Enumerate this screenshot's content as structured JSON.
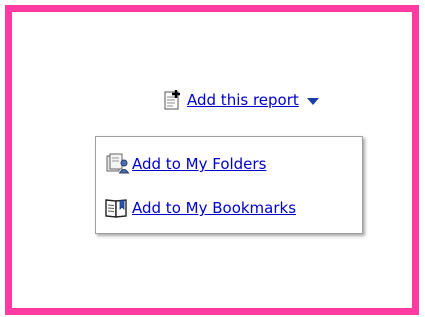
{
  "add_report": {
    "label": "Add this report",
    "icon": "add-report-icon"
  },
  "menu": {
    "items": [
      {
        "label": "Add to My Folders",
        "icon": "folders-icon"
      },
      {
        "label": "Add to My Bookmarks",
        "icon": "bookmarks-icon"
      }
    ]
  },
  "colors": {
    "frame": "#ff3aa0",
    "link": "#0000cc"
  }
}
